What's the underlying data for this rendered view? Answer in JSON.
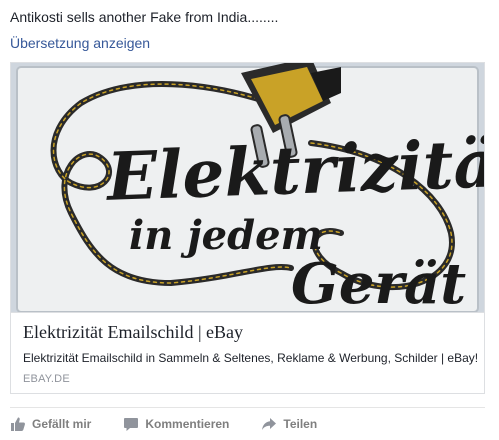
{
  "post": {
    "text": "Antikosti sells another Fake from India........",
    "translate_link": "Übersetzung anzeigen"
  },
  "link_card": {
    "image": {
      "name": "emailschild-image",
      "sign_line1": "Elektrizität",
      "sign_line2": "in jedem",
      "sign_line3": "Gerät"
    },
    "title": "Elektrizität Emailschild | eBay",
    "description": "Elektrizität Emailschild in Sammeln & Seltenes, Reklame & Werbung, Schilder | eBay!",
    "domain": "EBAY.DE"
  },
  "actions": [
    {
      "label": "Gefällt mir",
      "icon": "thumbs-up-icon"
    },
    {
      "label": "Kommentieren",
      "icon": "comment-icon"
    },
    {
      "label": "Teilen",
      "icon": "share-icon"
    }
  ],
  "colors": {
    "link": "#365899",
    "action_gray": "#7f7f7f",
    "border": "#dddfe2",
    "sign_background": "#eef0f1",
    "sign_text": "#1a1a1a",
    "plug_gold": "#c9a227"
  }
}
